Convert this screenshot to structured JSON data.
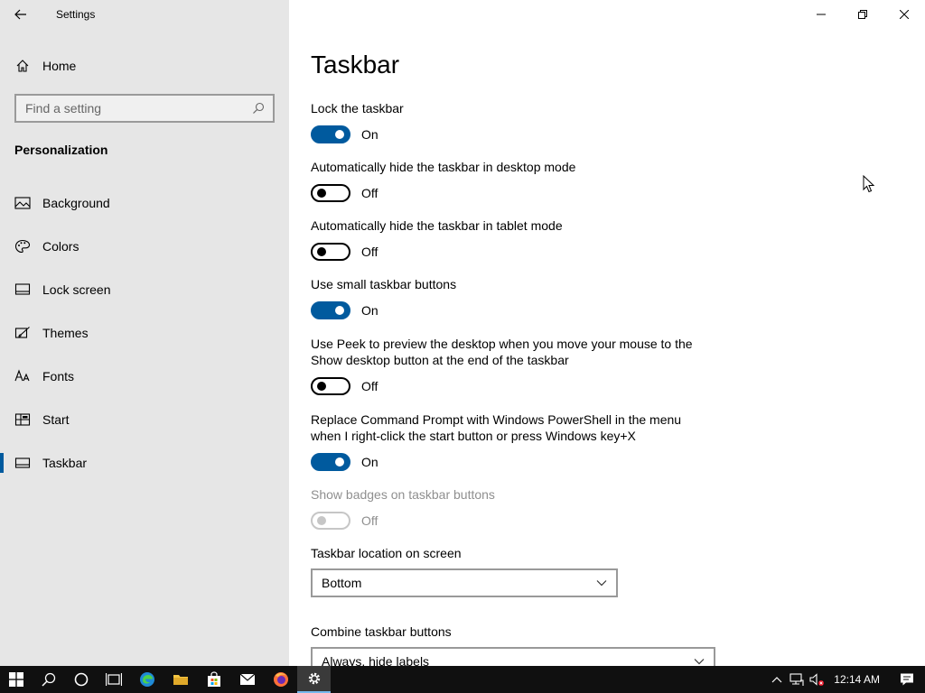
{
  "window": {
    "title": "Settings"
  },
  "sidebar": {
    "home_label": "Home",
    "search_placeholder": "Find a setting",
    "section_heading": "Personalization",
    "items": [
      {
        "label": "Background",
        "icon": "picture-icon",
        "active": false
      },
      {
        "label": "Colors",
        "icon": "palette-icon",
        "active": false
      },
      {
        "label": "Lock screen",
        "icon": "lock-screen-icon",
        "active": false
      },
      {
        "label": "Themes",
        "icon": "brush-icon",
        "active": false
      },
      {
        "label": "Fonts",
        "icon": "font-icon",
        "active": false
      },
      {
        "label": "Start",
        "icon": "start-icon",
        "active": false
      },
      {
        "label": "Taskbar",
        "icon": "taskbar-icon",
        "active": true
      }
    ]
  },
  "main": {
    "page_title": "Taskbar",
    "settings": [
      {
        "desc": "Lock the taskbar",
        "state": "On",
        "enabled": true
      },
      {
        "desc": "Automatically hide the taskbar in desktop mode",
        "state": "Off",
        "enabled": true
      },
      {
        "desc": "Automatically hide the taskbar in tablet mode",
        "state": "Off",
        "enabled": true
      },
      {
        "desc": "Use small taskbar buttons",
        "state": "On",
        "enabled": true
      },
      {
        "desc": "Use Peek to preview the desktop when you move your mouse to the Show desktop button at the end of the taskbar",
        "state": "Off",
        "enabled": true
      },
      {
        "desc": "Replace Command Prompt with Windows PowerShell in the menu when I right-click the start button or press Windows key+X",
        "state": "On",
        "enabled": true
      },
      {
        "desc": "Show badges on taskbar buttons",
        "state": "Off",
        "enabled": false
      }
    ],
    "location": {
      "label": "Taskbar location on screen",
      "value": "Bottom"
    },
    "combine": {
      "label": "Combine taskbar buttons",
      "value": "Always, hide labels"
    }
  },
  "taskbar": {
    "clock": "12:14 AM",
    "accent_color": "#76b9ed"
  },
  "colors": {
    "accent": "#005a9e",
    "sidebar_bg": "#e6e6e6",
    "taskbar_bg": "#101010"
  }
}
